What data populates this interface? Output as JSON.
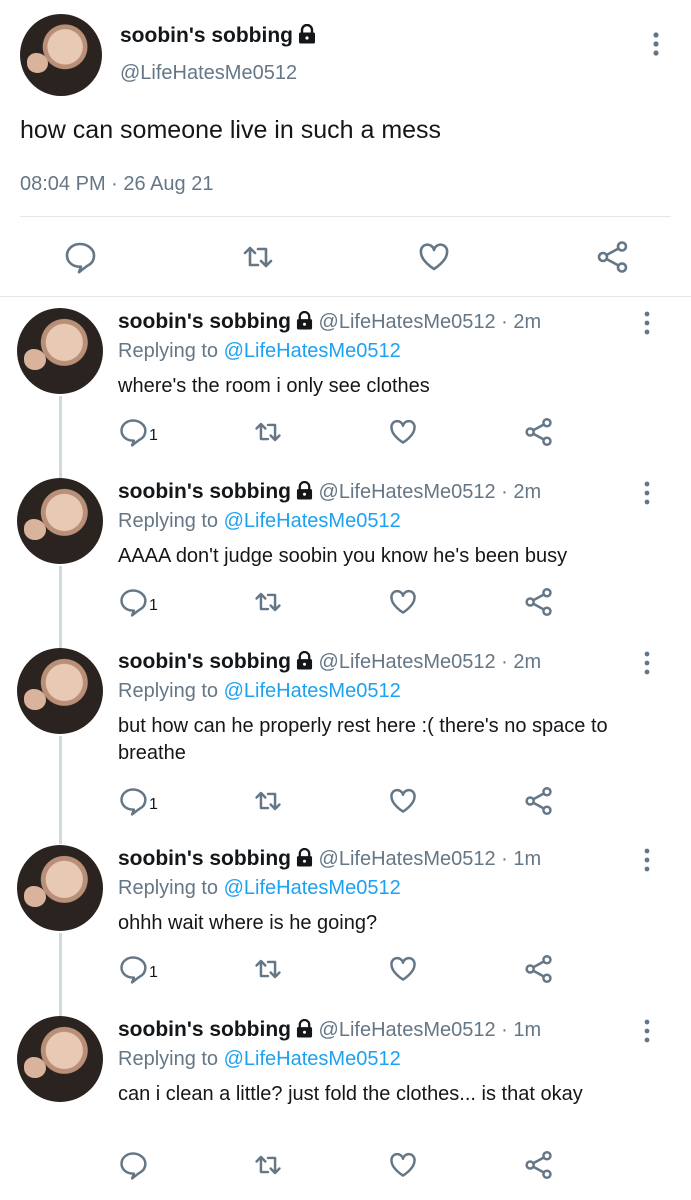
{
  "main_tweet": {
    "name": "soobin's sobbing",
    "handle": "@LifeHatesMe0512",
    "text": "how can someone live in such a mess",
    "time": "08:04 PM · 26 Aug 21"
  },
  "replies": [
    {
      "name": "soobin's sobbing",
      "meta": " @LifeHatesMe0512 · 2m",
      "replying_prefix": "Replying to ",
      "replying_to": "@LifeHatesMe0512",
      "text": "where's the room i only see clothes",
      "reply_count": "1"
    },
    {
      "name": "soobin's sobbing",
      "meta": " @LifeHatesMe0512 · 2m",
      "replying_prefix": "Replying to ",
      "replying_to": "@LifeHatesMe0512",
      "text": "AAAA don't judge soobin you know he's been busy",
      "reply_count": "1"
    },
    {
      "name": "soobin's sobbing",
      "meta": " @LifeHatesMe0512 · 2m",
      "replying_prefix": "Replying to ",
      "replying_to": "@LifeHatesMe0512",
      "text": "but how can he properly rest here :( there's no space to breathe",
      "reply_count": "1"
    },
    {
      "name": "soobin's sobbing",
      "meta": " @LifeHatesMe0512 · 1m",
      "replying_prefix": "Replying to ",
      "replying_to": "@LifeHatesMe0512",
      "text": "ohhh wait where is he going?",
      "reply_count": "1"
    },
    {
      "name": "soobin's sobbing",
      "meta": " @LifeHatesMe0512 · 1m",
      "replying_prefix": "Replying to ",
      "replying_to": "@LifeHatesMe0512",
      "text": "can i clean a little? just fold the clothes... is that okay",
      "reply_count": ""
    }
  ],
  "icons": [
    "lock-icon",
    "more-icon",
    "reply-icon",
    "retweet-icon",
    "like-icon",
    "share-icon"
  ],
  "colors": {
    "link": "#1da1f2",
    "muted": "#657786",
    "text": "#14171a",
    "icon": "#657786"
  }
}
